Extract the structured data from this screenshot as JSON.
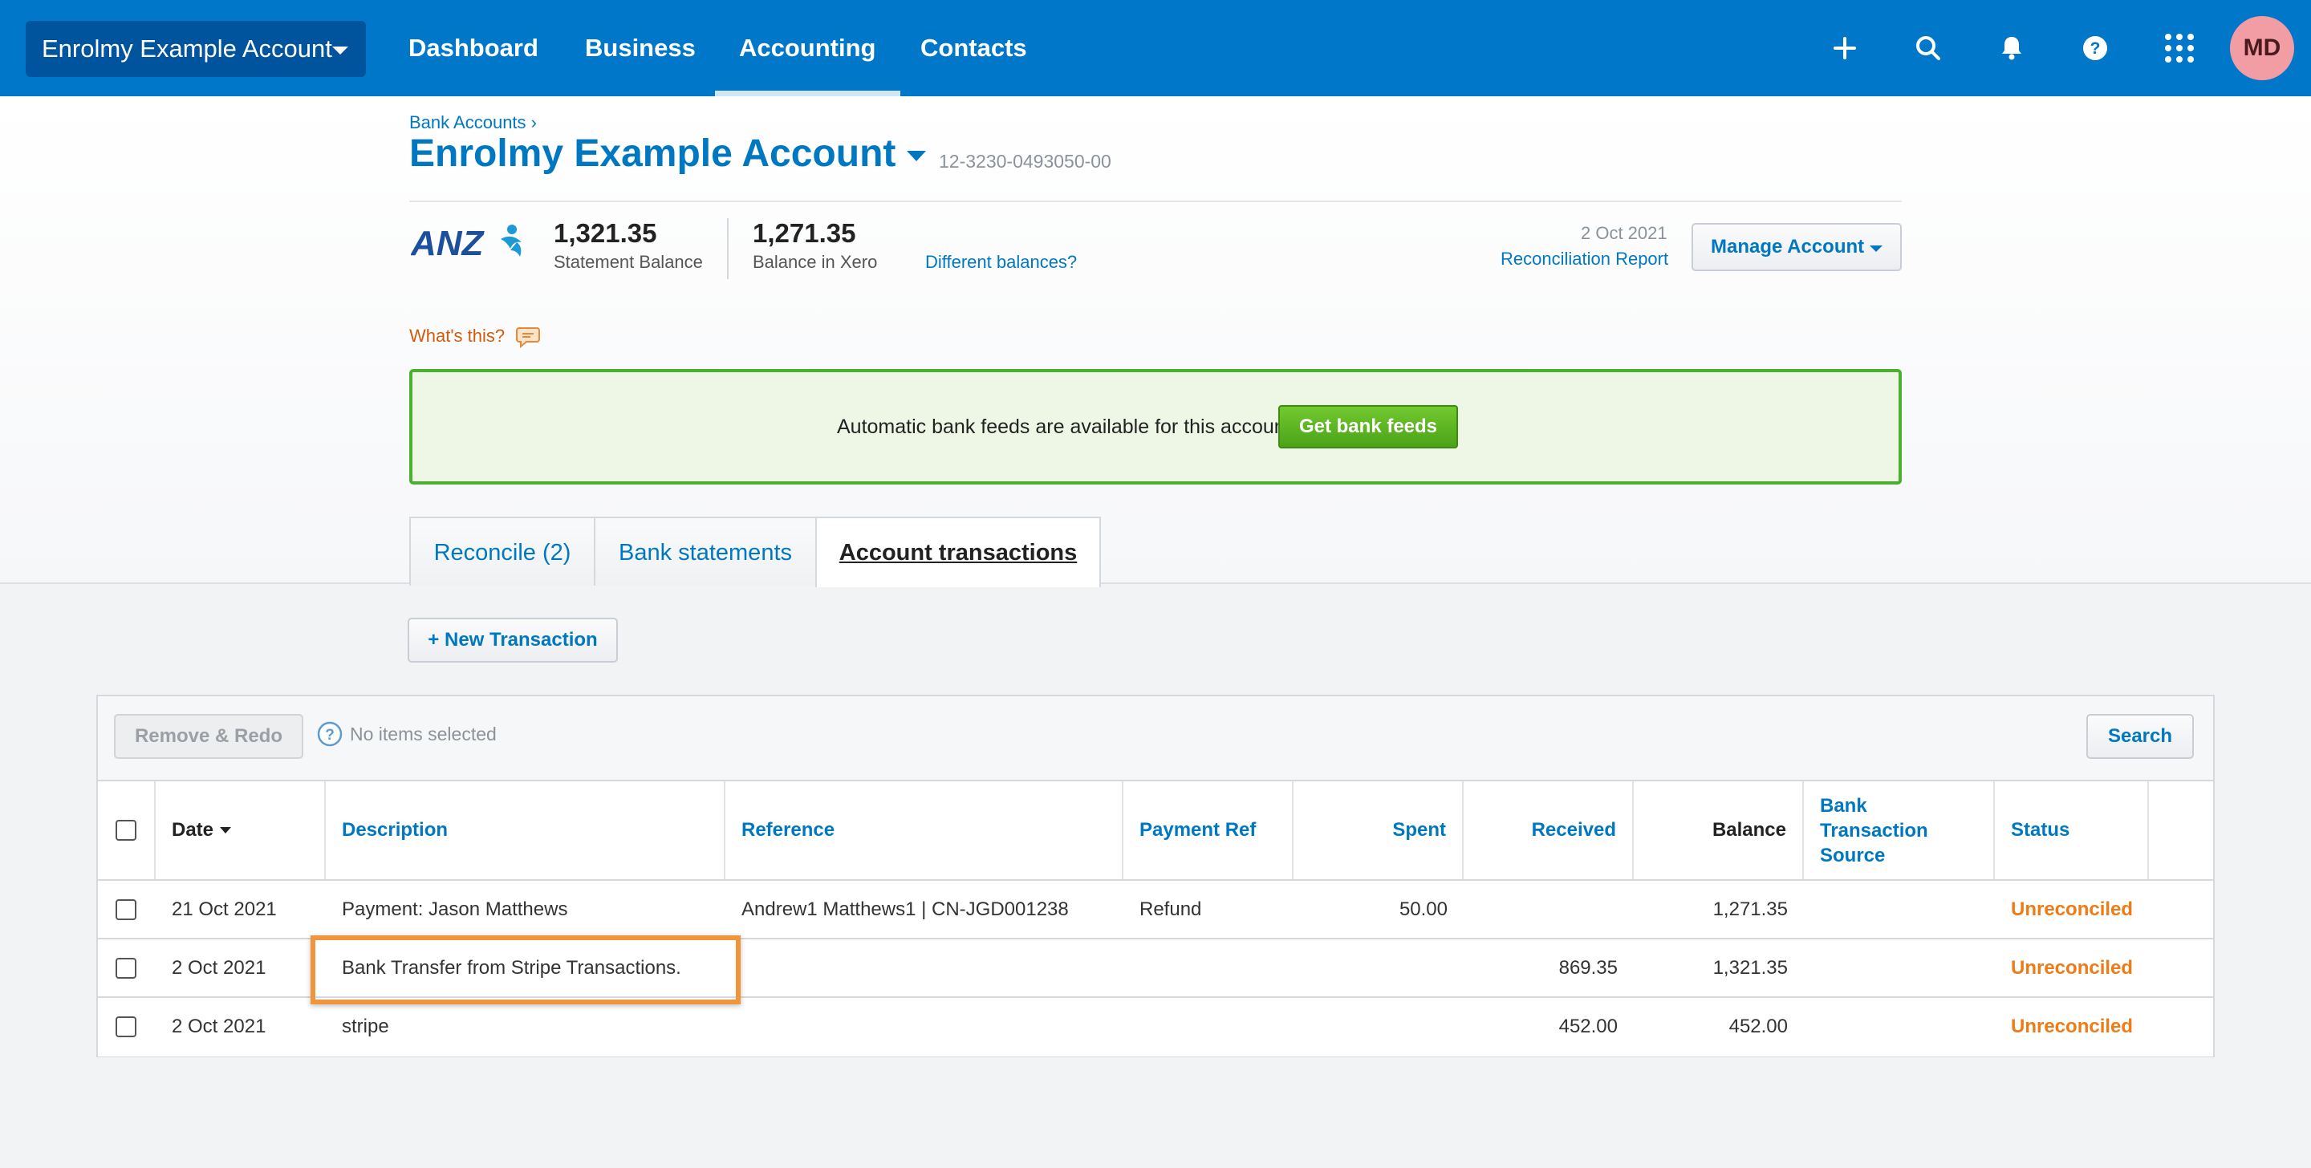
{
  "nav": {
    "org_name": "Enrolmy Example Account",
    "links": [
      "Dashboard",
      "Business",
      "Accounting",
      "Contacts"
    ],
    "active": "Accounting",
    "icons": [
      "plus-icon",
      "search-icon",
      "bell-icon",
      "help-icon",
      "apps-grid-icon"
    ],
    "avatar_initials": "MD",
    "colors": {
      "nav_bg": "#0077c8",
      "org_bg": "#00549e",
      "avatar_bg": "#f29ca3"
    }
  },
  "header": {
    "breadcrumb": "Bank Accounts ›",
    "title": "Enrolmy Example Account",
    "account_number": "12-3230-0493050-00",
    "bank_logo": "ANZ",
    "statement_balance": {
      "value": "1,321.35",
      "label": "Statement Balance"
    },
    "xero_balance": {
      "value": "1,271.35",
      "label": "Balance in Xero"
    },
    "different_balances": "Different balances?",
    "reconciliation_date": "2 Oct 2021",
    "reconciliation_report": "Reconciliation Report",
    "manage_account": "Manage Account",
    "whats_this": "What's this?"
  },
  "bank_feed": {
    "text": "Automatic bank feeds are available for this account",
    "button": "Get bank feeds"
  },
  "tabs": [
    {
      "label": "Reconcile (2)",
      "active": false
    },
    {
      "label": "Bank statements",
      "active": false
    },
    {
      "label": "Account transactions",
      "active": true
    }
  ],
  "actions": {
    "new_transaction": "+ New Transaction",
    "remove_redo": "Remove & Redo",
    "selection_status": "No items selected",
    "search": "Search"
  },
  "table": {
    "columns": [
      "Date",
      "Description",
      "Reference",
      "Payment Ref",
      "Spent",
      "Received",
      "Balance",
      "Bank Transaction Source",
      "Status"
    ],
    "rows": [
      {
        "date": "21 Oct 2021",
        "description": "Payment: Jason Matthews",
        "reference": "Andrew1 Matthews1 | CN-JGD001238",
        "payment_ref": "Refund",
        "spent": "50.00",
        "received": "",
        "balance": "1,271.35",
        "source": "",
        "status": "Unreconciled"
      },
      {
        "date": "2 Oct 2021",
        "description": "Bank Transfer from Stripe Transactions.",
        "reference": "",
        "payment_ref": "",
        "spent": "",
        "received": "869.35",
        "balance": "1,321.35",
        "source": "",
        "status": "Unreconciled"
      },
      {
        "date": "2 Oct 2021",
        "description": "stripe",
        "reference": "",
        "payment_ref": "",
        "spent": "",
        "received": "452.00",
        "balance": "452.00",
        "source": "",
        "status": "Unreconciled"
      }
    ],
    "highlighted_row": 1,
    "colors": {
      "status": "#ef7b16",
      "link": "#0078c1",
      "highlight": "#f0953b"
    }
  }
}
